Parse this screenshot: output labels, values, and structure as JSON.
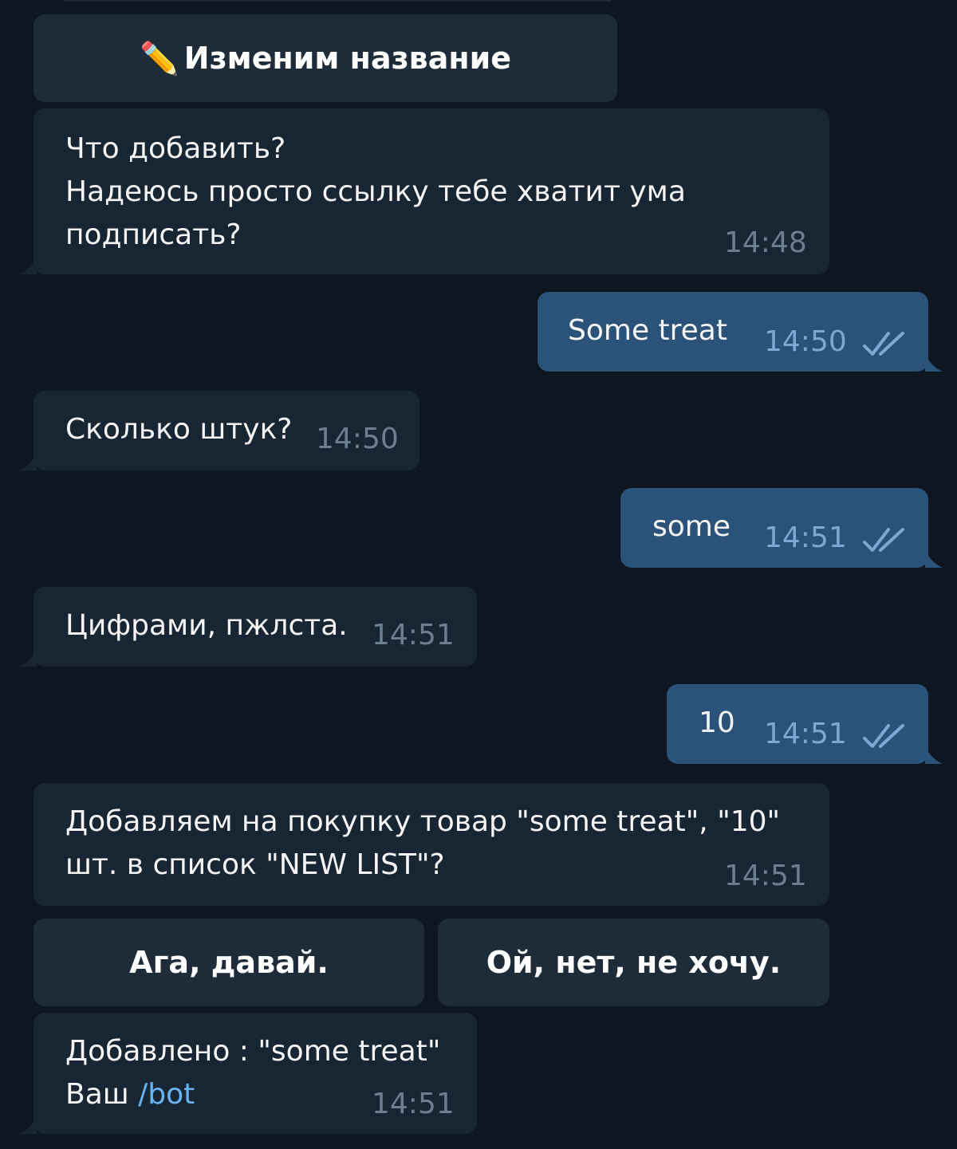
{
  "keyboard_top": {
    "button_label": "Изменим название",
    "icon": "pencil-icon"
  },
  "messages": [
    {
      "dir": "in",
      "text": "Что добавить?\nНадеюсь просто ссылку тебе хватит ума подписать?",
      "time": "14:48"
    },
    {
      "dir": "out",
      "text": "Some treat",
      "time": "14:50",
      "status": "read"
    },
    {
      "dir": "in",
      "text": "Сколько штук?",
      "time": "14:50"
    },
    {
      "dir": "out",
      "text": "some",
      "time": "14:51",
      "status": "read"
    },
    {
      "dir": "in",
      "text": "Цифрами, пжлста.",
      "time": "14:51"
    },
    {
      "dir": "out",
      "text": "10",
      "time": "14:51",
      "status": "read"
    },
    {
      "dir": "in",
      "text": "Добавляем на покупку товар \"some treat\", \"10\" шт. в список \"NEW LIST\"?",
      "time": "14:51"
    },
    {
      "dir": "in",
      "text_prefix": "Добавлено : \"some treat\"\nВаш ",
      "link": "/bot",
      "time": "14:51"
    }
  ],
  "keyboard_confirm": {
    "yes_label": "Ага, давай.",
    "no_label": "Ой, нет, не хочу."
  },
  "colors": {
    "background": "#0e1621",
    "incoming_bubble": "#182533",
    "outgoing_bubble": "#2b5278",
    "keyboard_button": "#1e2c3a",
    "link": "#6ab3f3"
  }
}
